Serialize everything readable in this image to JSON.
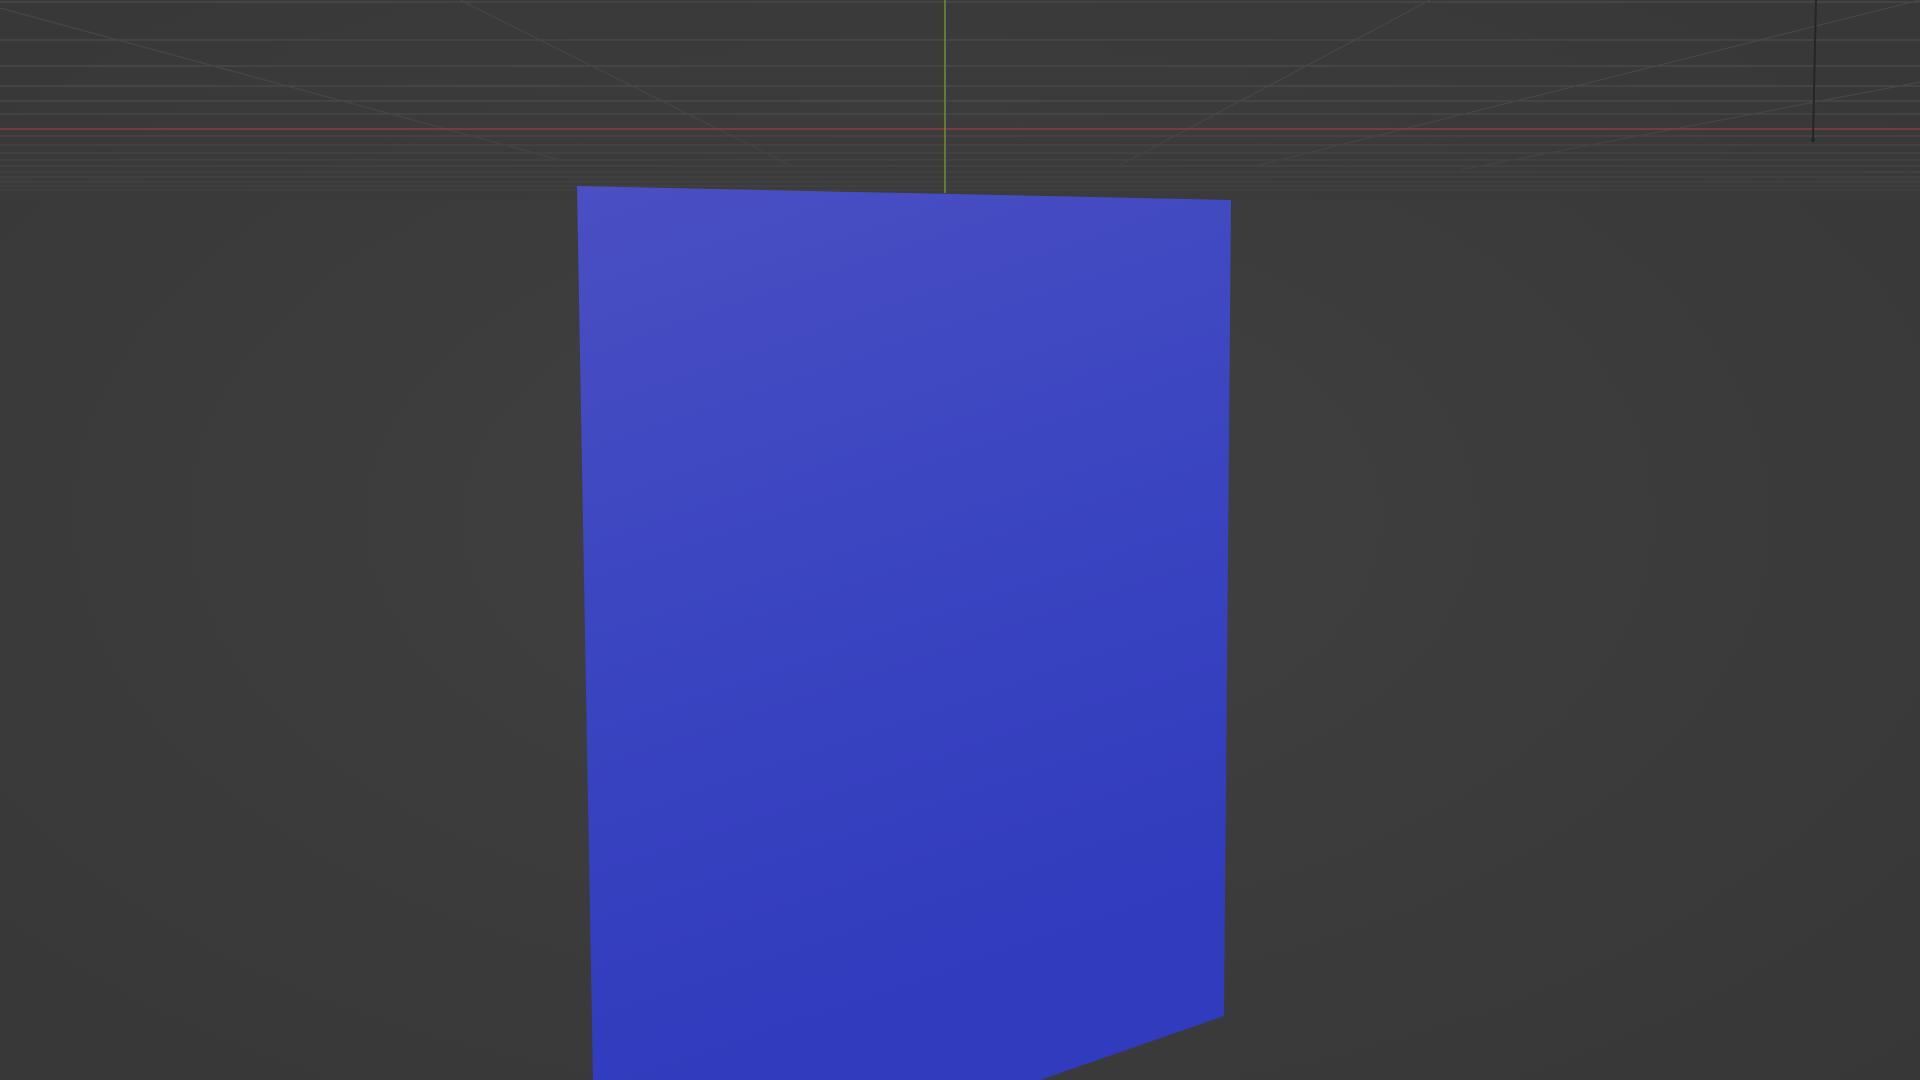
{
  "viewport": {
    "background_color": "#3c3c3c",
    "grid_line_color": "#4a4a4a",
    "x_axis_color": "#8a3c44",
    "y_axis_color": "#6f8a2a",
    "object_color": "#3a43c4",
    "object_highlight_color": "#4a52c2",
    "object_shadow_color": "#3038bc"
  }
}
